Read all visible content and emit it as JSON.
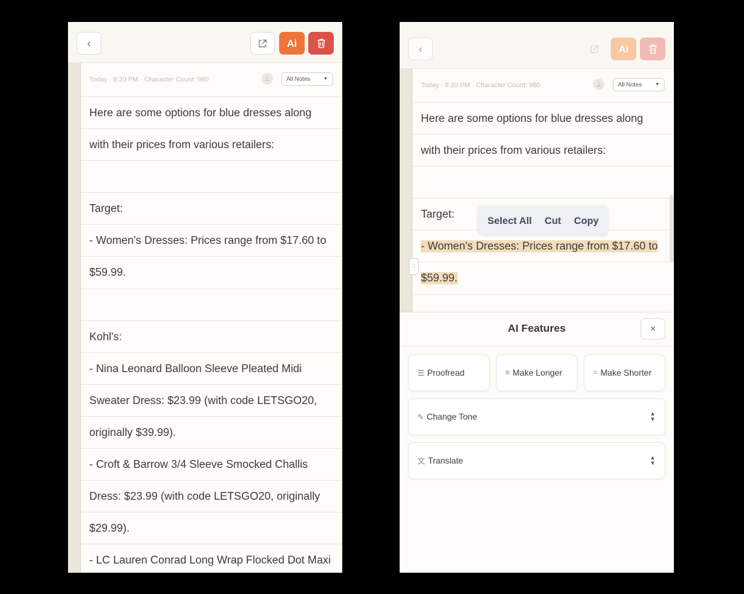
{
  "meta_text": "Today · 8:20 PM · Character Count: 980",
  "notes_filter": "All Notes",
  "toolbar": {
    "ai_label": "Ai"
  },
  "left_lines": [
    "Here are some options for blue dresses along",
    "with their prices from various retailers:",
    "",
    "Target:",
    "- Women's Dresses: Prices range from $17.60 to",
    "$59.99.",
    "",
    "Kohl's:",
    "- Nina Leonard Balloon Sleeve Pleated Midi",
    "Sweater Dress: $23.99 (with code LETSGO20,",
    "originally $39.99).",
    "- Croft & Barrow 3/4 Sleeve Smocked Challis",
    "Dress: $23.99 (with code LETSGO20, originally",
    "$29.99).",
    "- LC Lauren Conrad Long Wrap Flocked Dot Maxi"
  ],
  "right_lines": [
    "Here are some options for blue dresses along",
    "with their prices from various retailers:",
    "",
    "Target:",
    "- Women's Dresses: Prices range from $17.60 to",
    "$59.99.",
    ""
  ],
  "context_menu": [
    "Select All",
    "Cut",
    "Copy"
  ],
  "ai_panel": {
    "title": "AI Features",
    "close": "×",
    "proofread": "Proofread",
    "make_longer": "Make Longer",
    "make_shorter": "Make Shorter",
    "change_tone": "Change Tone",
    "translate": "Translate"
  },
  "colors": {
    "accent": "#f0743a",
    "danger": "#d9534a",
    "highlight": "#f3dcbc"
  }
}
